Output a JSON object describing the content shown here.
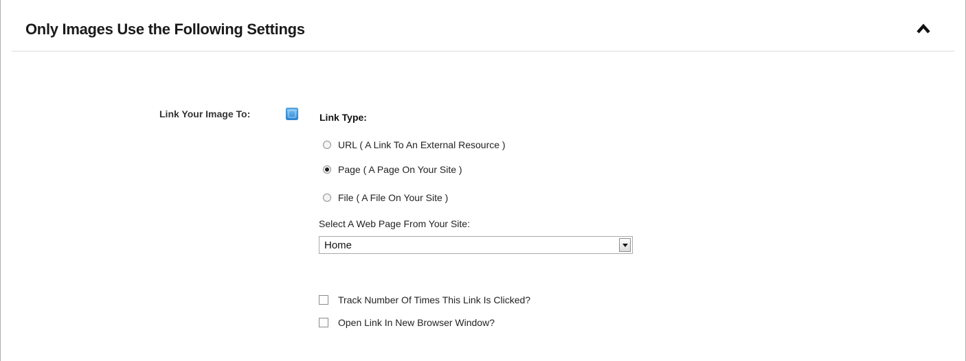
{
  "panel": {
    "title": "Only Images Use the Following Settings",
    "collapse_icon": "chevron-up-icon"
  },
  "form": {
    "field_label": "Link Your Image To:",
    "help_icon": "help-icon",
    "link_type_label": "Link Type:",
    "link_type_options": [
      {
        "label": "URL ( A Link To An External Resource )",
        "checked": false
      },
      {
        "label": "Page ( A Page On Your Site )",
        "checked": true
      },
      {
        "label": "File ( A File On Your Site )",
        "checked": false
      }
    ],
    "select_caption": "Select A Web Page From Your Site:",
    "select_value": "Home",
    "checkboxes": [
      {
        "label": "Track Number Of Times This Link Is Clicked?",
        "checked": false
      },
      {
        "label": "Open Link In New Browser Window?",
        "checked": false
      }
    ]
  },
  "colors": {
    "help_icon_blue": "#3c9be0",
    "panel_border": "#b0b0b0"
  }
}
